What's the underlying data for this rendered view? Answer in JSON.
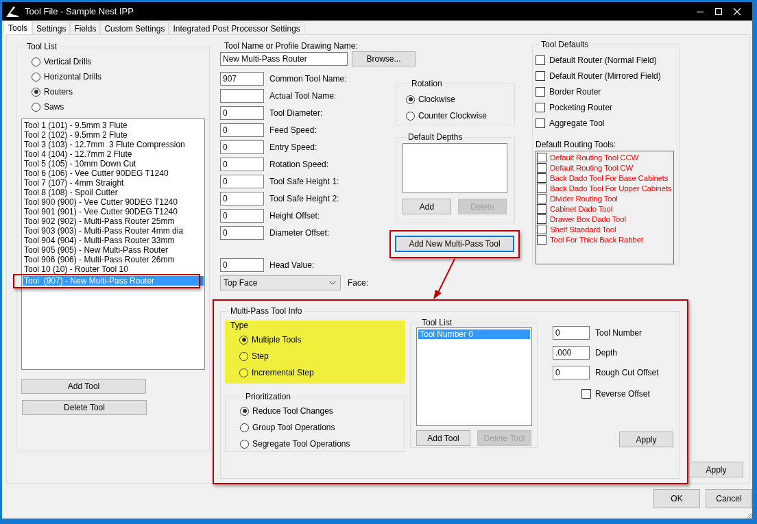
{
  "window": {
    "title": "Tool File - Sample Nest IPP"
  },
  "tabs": [
    {
      "label": "Tools",
      "selected": true
    },
    {
      "label": "Settings",
      "selected": false
    },
    {
      "label": "Fields",
      "selected": false
    },
    {
      "label": "Custom Settings",
      "selected": false
    },
    {
      "label": "Integrated Post Processor Settings",
      "selected": false
    }
  ],
  "tool_list": {
    "title": "Tool List",
    "categories": [
      {
        "label": "Vertical Drills",
        "selected": false
      },
      {
        "label": "Horizontal Drills",
        "selected": false
      },
      {
        "label": "Routers",
        "selected": true
      },
      {
        "label": "Saws",
        "selected": false
      }
    ],
    "items": [
      {
        "label": "Tool 1 (101) - 9.5mm 3 Flute",
        "selected": false
      },
      {
        "label": "Tool 2 (102) - 9.5mm 2 Flute",
        "selected": false
      },
      {
        "label": "Tool 3 (103) - 12.7mm  3 Flute Compression",
        "selected": false
      },
      {
        "label": "Tool 4 (104) - 12.7mm 2 Flute",
        "selected": false
      },
      {
        "label": "Tool 5 (105) - 10mm Down Cut",
        "selected": false
      },
      {
        "label": "Tool 6 (106) - Vee Cutter 90DEG T1240",
        "selected": false
      },
      {
        "label": "Tool 7 (107) - 4mm Straight",
        "selected": false
      },
      {
        "label": "Tool 8 (108) - Spoil Cutter",
        "selected": false
      },
      {
        "label": "Tool 900 (900) - Vee Cutter 90DEG T1240",
        "selected": false
      },
      {
        "label": "Tool 901 (901) - Vee Cutter 90DEG T1240",
        "selected": false
      },
      {
        "label": "Tool 902 (902) - Multi-Pass Router 25mm",
        "selected": false
      },
      {
        "label": "Tool 903 (903) - Multi-Pass Router 4mm dia",
        "selected": false
      },
      {
        "label": "Tool 904 (904) - Multi-Pass Router 33mm",
        "selected": false
      },
      {
        "label": "Tool 905 (905) - New Multi-Pass Router",
        "selected": false
      },
      {
        "label": "Tool 906 (906) - Multi-Pass Router 26mm",
        "selected": false
      },
      {
        "label": "Tool 10 (10) - Router Tool 10",
        "selected": false
      },
      {
        "label": "Tool  (907) - New Multi-Pass Router",
        "selected": true
      }
    ],
    "buttons": [
      "Add Tool",
      "Delete Tool"
    ]
  },
  "tool_name": {
    "label": "Tool Name or Profile Drawing Name:",
    "value": "New Multi-Pass Router",
    "button": "Browse..."
  },
  "fields": [
    {
      "value": "907",
      "label": "Common Tool Name:"
    },
    {
      "label": "Actual Tool Name:"
    },
    {
      "value": "0",
      "label": "Tool Diameter:"
    },
    {
      "value": "0",
      "label": "Feed Speed:"
    },
    {
      "value": "0",
      "label": "Entry Speed:"
    },
    {
      "value": "0",
      "label": "Rotation Speed:"
    },
    {
      "value": "0",
      "label": "Tool Safe Height 1:"
    },
    {
      "value": "0",
      "label": "Tool Safe Height 2:"
    },
    {
      "value": "0",
      "label": "Height Offset:"
    },
    {
      "value": "0",
      "label": "Diameter Offset:"
    }
  ],
  "head_value": {
    "value": "0",
    "label": "Head Value:"
  },
  "face": {
    "value": "Top Face",
    "label": "Face:"
  },
  "rotation": {
    "title": "Rotation",
    "options": [
      {
        "label": "Clockwise",
        "selected": true
      },
      {
        "label": "Counter Clockwise",
        "selected": false
      }
    ]
  },
  "default_depths": {
    "title": "Default Depths",
    "buttons": [
      {
        "label": "Add",
        "disabled": false
      },
      {
        "label": "Delete",
        "disabled": true
      }
    ]
  },
  "add_multipass_button": "Add New Multi-Pass Tool",
  "tool_defaults": {
    "title": "Tool Defaults",
    "options": [
      {
        "label": "Default Router (Normal Field)",
        "checked": false
      },
      {
        "label": "Default Router (Mirrored Field)",
        "checked": false
      },
      {
        "label": "Border Router",
        "checked": false
      },
      {
        "label": "Pocketing Router",
        "checked": false
      },
      {
        "label": "Aggregate Tool",
        "checked": false
      }
    ],
    "routing_label": "Default Routing Tools:",
    "routing_tools": [
      {
        "label": "Default Routing Tool CCW",
        "checked": false
      },
      {
        "label": "Default Routing Tool CW",
        "checked": false
      },
      {
        "label": "Back Dado Tool For Base Cabinets",
        "checked": false
      },
      {
        "label": "Back Dado Tool For Upper Cabinets",
        "checked": false
      },
      {
        "label": "Divider Routing Tool",
        "checked": false
      },
      {
        "label": "Cabinet Dado Tool",
        "checked": false
      },
      {
        "label": "Drawer Box Dado Tool",
        "checked": false
      },
      {
        "label": "Shelf Standard Tool",
        "checked": false
      },
      {
        "label": "Tool For Thick Back Rabbet",
        "checked": false
      }
    ]
  },
  "multipass": {
    "title": "Multi-Pass Tool Info",
    "type": {
      "title": "Type",
      "options": [
        {
          "label": "Multiple Tools",
          "selected": true
        },
        {
          "label": "Step",
          "selected": false
        },
        {
          "label": "Incremental Step",
          "selected": false
        }
      ]
    },
    "prioritization": {
      "title": "Prioritization",
      "options": [
        {
          "label": "Reduce Tool Changes",
          "selected": true
        },
        {
          "label": "Group Tool Operations",
          "selected": false
        },
        {
          "label": "Segregate Tool Operations",
          "selected": false
        }
      ]
    },
    "tool_list": {
      "title": "Tool List",
      "items": [
        {
          "label": "Tool Number 0",
          "selected": true
        }
      ],
      "buttons": [
        {
          "label": "Add Tool",
          "disabled": false
        },
        {
          "label": "Delete Tool",
          "disabled": true
        }
      ]
    },
    "fields": [
      {
        "value": "0",
        "label": "Tool Number"
      },
      {
        "value": ".000",
        "label": "Depth"
      },
      {
        "value": "0",
        "label": "Rough Cut Offset"
      }
    ],
    "reverse_offset": {
      "label": "Reverse Offset",
      "checked": false
    },
    "apply": "Apply"
  },
  "apply": "Apply",
  "buttons": [
    "OK",
    "Cancel"
  ]
}
